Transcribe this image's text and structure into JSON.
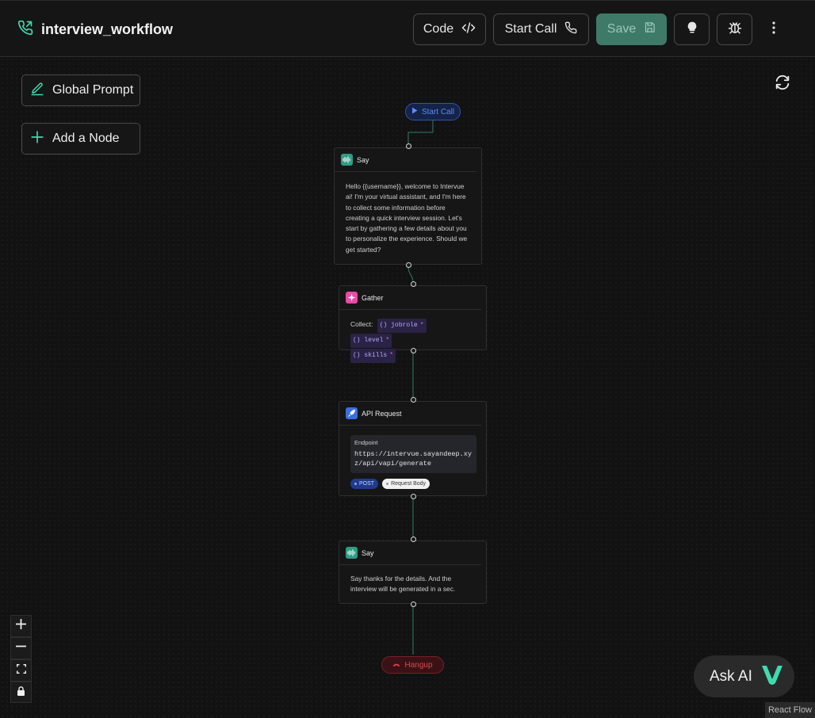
{
  "header": {
    "title": "interview_workflow",
    "buttons": {
      "code": "Code",
      "start_call": "Start Call",
      "save": "Save"
    }
  },
  "sidebar": {
    "global_prompt": "Global Prompt",
    "add_node": "Add a Node"
  },
  "flow": {
    "start_pill": "Start Call",
    "hangup_pill": "Hangup",
    "nodes": {
      "say1": {
        "title": "Say",
        "text": "Hello {{username}}, welcome to Intervue ai! I'm your virtual assistant, and I'm here to collect some information before creating a quick interview session. Let's start by gathering a few details about you to personalize the experience. Should we get started?"
      },
      "gather": {
        "title": "Gather",
        "collect_label": "Collect:",
        "vars": [
          "jobrole",
          "level",
          "skills"
        ]
      },
      "api": {
        "title": "API Request",
        "endpoint_label": "Endpoint",
        "endpoint": "https://intervue.sayandeep.xyz/api/vapi/generate",
        "method": "POST",
        "body_chip": "Request Body"
      },
      "say2": {
        "title": "Say",
        "text": "Say thanks for the details. And the interview will be generated in a sec."
      }
    }
  },
  "ask_ai": "Ask AI",
  "attribution": "React Flow",
  "colors": {
    "accent_green": "#3ddbb0",
    "save_bg": "#3f7a68",
    "start_blue": "#5b8cff",
    "hangup_red": "#e2444e",
    "gather_pink": "#e84aa8",
    "api_blue": "#3b6fe0",
    "say_teal": "#2e9c86"
  },
  "icons": [
    "phone-icon",
    "code-icon",
    "save-icon",
    "lightbulb-icon",
    "bug-icon",
    "kebab-icon",
    "edit-icon",
    "plus-icon",
    "refresh-icon",
    "waveform-icon",
    "sparkle-icon",
    "rocket-icon",
    "play-icon",
    "hangup-icon",
    "minus-icon",
    "fit-view-icon",
    "lock-icon",
    "vapi-logo-icon"
  ]
}
